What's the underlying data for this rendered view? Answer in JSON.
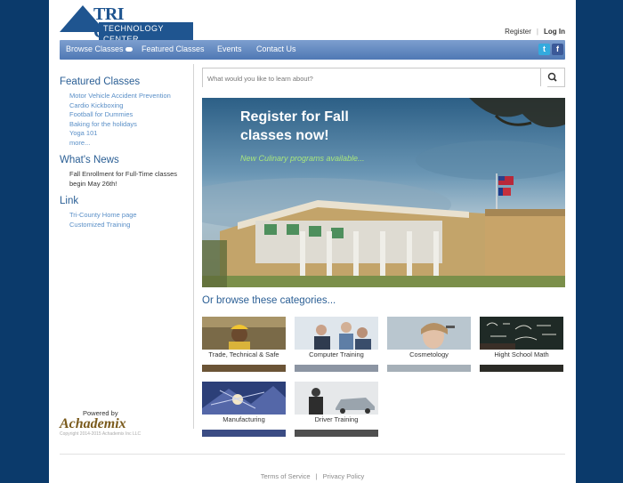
{
  "header": {
    "logo_title": "TRI COUNTY",
    "logo_subtitle": "TECHNOLOGY CENTER",
    "register": "Register",
    "login": "Log In"
  },
  "nav": {
    "items": [
      "Browse Classes",
      "Featured Classes",
      "Events",
      "Contact Us"
    ],
    "twitter": "t",
    "facebook": "f"
  },
  "sidebar": {
    "featured_heading": "Featured Classes",
    "featured_links": [
      "Motor Vehicle Accident Prevention",
      "Cardio Kickboxing",
      "Football for Dummies",
      "Baking for the holidays",
      "Yoga 101",
      "more..."
    ],
    "news_heading": "What's News",
    "news_items": [
      "Fall Enrollment for Full-Time classes",
      "begin May 26th!"
    ],
    "link_heading": "Link",
    "links": [
      "Tri-County Home page",
      "Customized Training"
    ],
    "powered_by": "Powered by",
    "achademix": "Achademix",
    "copyright": "Copyright 2014-2015 Achademix Inc LLC"
  },
  "search": {
    "placeholder": "What would you like to learn about?"
  },
  "banner": {
    "line1": "Register for Fall",
    "line2": "classes now!",
    "subtitle": "New Culinary programs available..."
  },
  "categories": {
    "heading": "Or browse these categories...",
    "items": [
      "Trade, Technical & Safe",
      "Computer Training",
      "Cosmetology",
      "Hight School Math",
      "Manufacturing",
      "Driver Training"
    ]
  },
  "footer": {
    "terms": "Terms of Service",
    "separator": "|",
    "privacy": "Privacy Policy"
  },
  "colors": {
    "background": "#0b3a6b",
    "nav_bar": "#5b81bb",
    "heading_blue": "#2b5f95",
    "link_blue": "#5a8fc7"
  }
}
